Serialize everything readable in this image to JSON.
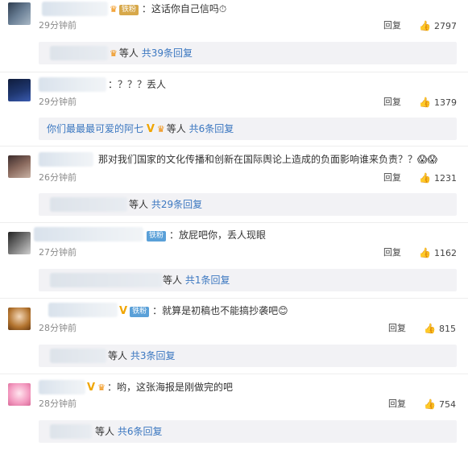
{
  "comments": [
    {
      "badge": "铁粉",
      "text": "：这话你自己信吗",
      "time": "29分钟前",
      "reply_label": "回复",
      "likes": "2797",
      "sub": {
        "suffix": "等人",
        "link": "共39条回复"
      }
    },
    {
      "text": "：？？？丢人",
      "time": "29分钟前",
      "reply_label": "回复",
      "likes": "1379",
      "sub": {
        "name": "你们最最最可爱的阿七",
        "suffix": "等人",
        "link": "共6条回复"
      }
    },
    {
      "text": "那对我们国家的文化传播和创新在国际舆论上造成的负面影响谁来负责？？",
      "time": "26分钟前",
      "reply_label": "回复",
      "likes": "1231",
      "sub": {
        "suffix": "等人",
        "link": "共29条回复"
      }
    },
    {
      "badge": "铁粉",
      "text": "：放屁吧你，丢人现眼",
      "time": "27分钟前",
      "reply_label": "回复",
      "likes": "1162",
      "sub": {
        "suffix": "等人",
        "link": "共1条回复"
      }
    },
    {
      "badge": "铁粉",
      "text": "：就算是初稿也不能搞抄袭吧",
      "time": "28分钟前",
      "reply_label": "回复",
      "likes": "815",
      "sub": {
        "suffix": "等人",
        "link": "共3条回复"
      }
    },
    {
      "text": "：哟，这张海报是刚做完的吧",
      "time": "28分钟前",
      "reply_label": "回复",
      "likes": "754",
      "sub": {
        "suffix": "等人",
        "link": "共6条回复"
      }
    }
  ]
}
